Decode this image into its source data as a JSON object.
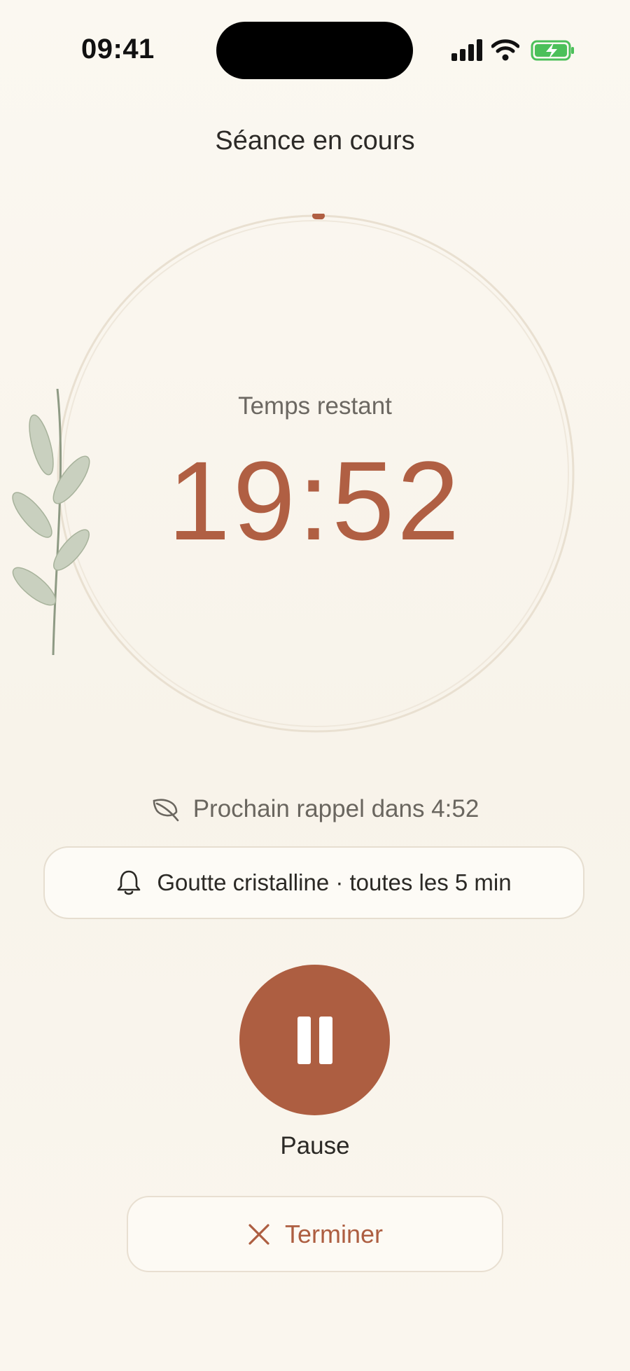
{
  "status_bar": {
    "time": "09:41",
    "battery_state": "charging"
  },
  "header": {
    "title": "Séance en cours"
  },
  "timer": {
    "label": "Temps restant",
    "remaining": "19:52",
    "progress": 0.007
  },
  "reminder": {
    "next_text": "Prochain rappel dans 4:52",
    "sound_text": "Goutte cristalline · toutes les 5 min"
  },
  "controls": {
    "pause_label": "Pause",
    "end_label": "Terminer"
  },
  "colors": {
    "accent": "#ad5e41",
    "ring": "#e7dccb",
    "background": "#fbf8f1",
    "battery": "#4cc05a"
  }
}
